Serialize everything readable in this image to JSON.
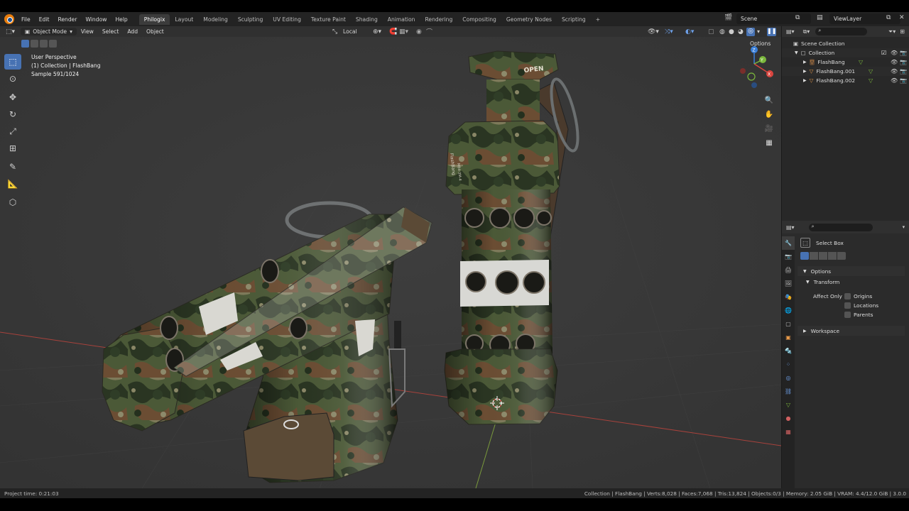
{
  "menu": [
    "File",
    "Edit",
    "Render",
    "Window",
    "Help"
  ],
  "workspaces": [
    "Philogix",
    "Layout",
    "Modeling",
    "Sculpting",
    "UV Editing",
    "Texture Paint",
    "Shading",
    "Animation",
    "Rendering",
    "Compositing",
    "Geometry Nodes",
    "Scripting"
  ],
  "active_workspace": "Philogix",
  "add_tab": "+",
  "scene": "Scene",
  "view_layer": "ViewLayer",
  "viewport_header": {
    "mode": "Object Mode",
    "items": [
      "View",
      "Select",
      "Add",
      "Object"
    ],
    "transform_orientation": "Local",
    "options_label": "Options"
  },
  "overlay": {
    "line1": "User Perspective",
    "line2": "(1) Collection | FlashBang",
    "line3": "Sample 591/1024"
  },
  "decals": {
    "open": "OPEN",
    "brand": "FlashBang",
    "code": "M84-3M-4"
  },
  "gizmo": {
    "x": "X",
    "y": "Y",
    "z": "Z"
  },
  "outliner": {
    "root": "Scene Collection",
    "collection": "Collection",
    "objects": [
      "FlashBang",
      "FlashBang.001",
      "FlashBang.002"
    ]
  },
  "properties": {
    "tool": "Select Box",
    "options": "Options",
    "transform": "Transform",
    "affect_only": "Affect Only",
    "checks": [
      "Origins",
      "Locations",
      "Parents"
    ],
    "workspace": "Workspace"
  },
  "status": {
    "left": "Project time: 0:21:03",
    "right": "Collection | FlashBang | Verts:8,028 | Faces:7,068 | Tris:13,824 | Objects:0/3 | Memory: 2.05 GiB | VRAM: 4.4/12.0 GiB | 3.0.0"
  },
  "colors": {
    "accent": "#4772b3",
    "axis_x": "#d9453f",
    "axis_y": "#7bb83c",
    "axis_z": "#3a7fd9",
    "camo_dark": "#2c3a24",
    "camo_mid": "#4a5a36"
  }
}
